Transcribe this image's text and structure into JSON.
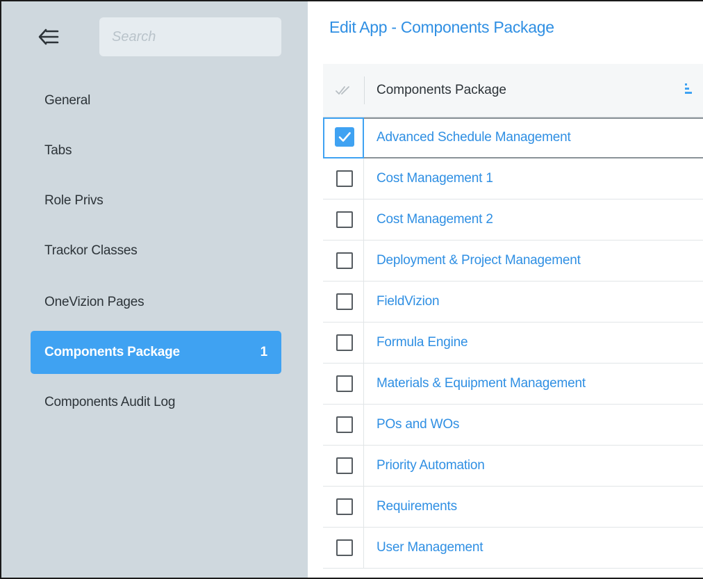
{
  "sidebar": {
    "search_placeholder": "Search",
    "items": [
      {
        "label": "General",
        "badge": ""
      },
      {
        "label": "Tabs",
        "badge": ""
      },
      {
        "label": "Role Privs",
        "badge": ""
      },
      {
        "label": "Trackor Classes",
        "badge": ""
      },
      {
        "label": "OneVizion Pages",
        "badge": ""
      },
      {
        "label": "Components Package",
        "badge": "1",
        "active": true
      },
      {
        "label": "Components Audit Log",
        "badge": ""
      }
    ]
  },
  "main": {
    "title": "Edit App - Components Package",
    "grid": {
      "column_header": "Components Package",
      "rows": [
        {
          "label": "Advanced Schedule Management",
          "checked": true
        },
        {
          "label": "Cost Management 1",
          "checked": false
        },
        {
          "label": "Cost Management 2",
          "checked": false
        },
        {
          "label": "Deployment & Project Management",
          "checked": false
        },
        {
          "label": "FieldVizion",
          "checked": false
        },
        {
          "label": "Formula Engine",
          "checked": false
        },
        {
          "label": "Materials & Equipment Management",
          "checked": false
        },
        {
          "label": "POs and WOs",
          "checked": false
        },
        {
          "label": "Priority Automation",
          "checked": false
        },
        {
          "label": "Requirements",
          "checked": false
        },
        {
          "label": "User Management",
          "checked": false
        }
      ]
    }
  },
  "colors": {
    "accent": "#3fa2f2",
    "link": "#2f8fe3",
    "sidebar_bg": "#cfd8de"
  }
}
